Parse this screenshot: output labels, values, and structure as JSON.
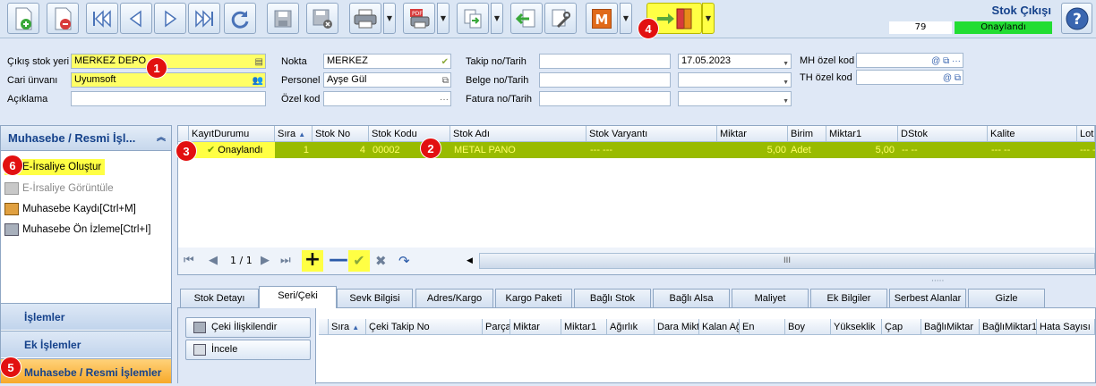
{
  "header": {
    "title": "Stok Çıkışı",
    "doc_no": "79",
    "status": "Onaylandı"
  },
  "form": {
    "cikis_stok_yeri": {
      "label": "Çıkış stok yeri",
      "value": "MERKEZ DEPO"
    },
    "cari_unvani": {
      "label": "Cari ünvanı",
      "value": "Uyumsoft"
    },
    "aciklama": {
      "label": "Açıklama",
      "value": ""
    },
    "nokta": {
      "label": "Nokta",
      "value": "MERKEZ"
    },
    "personel": {
      "label": "Personel",
      "value": "Ayşe Gül"
    },
    "ozel_kod": {
      "label": "Özel kod",
      "value": ""
    },
    "takip_no": {
      "label": "Takip no/Tarih",
      "value": "",
      "date": "17.05.2023"
    },
    "belge_no": {
      "label": "Belge no/Tarih",
      "value": "",
      "date": ""
    },
    "fatura_no": {
      "label": "Fatura no/Tarih",
      "value": "",
      "date": ""
    },
    "mh_ozel_kod": {
      "label": "MH özel kod",
      "value": ""
    },
    "th_ozel_kod": {
      "label": "TH özel kod",
      "value": ""
    }
  },
  "left_panel": {
    "title": "Muhasebe / Resmi İşl...",
    "items": [
      {
        "label": "E-İrsaliye Oluştur",
        "enabled": true
      },
      {
        "label": "E-İrsaliye Görüntüle",
        "enabled": false
      },
      {
        "label": "Muhasebe Kaydı[Ctrl+M]",
        "enabled": true
      },
      {
        "label": "Muhasebe Ön İzleme[Ctrl+I]",
        "enabled": true
      }
    ],
    "sections": [
      "İşlemler",
      "Ek İşlemler",
      "Muhasebe / Resmi İşlemler"
    ]
  },
  "grid": {
    "columns": [
      "KayıtDurumu",
      "Sıra",
      "Stok No",
      "Stok Kodu",
      "Stok Adı",
      "Stok Varyantı",
      "Miktar",
      "Birim",
      "Miktar1",
      "DStok",
      "Kalite",
      "Lot"
    ],
    "rows": [
      {
        "kayit_durumu": "Onaylandı",
        "sira": "1",
        "stok_no": "4",
        "stok_kodu": "00002",
        "stok_adi": "METAL PANO",
        "varyant": "--- ---",
        "miktar": "5,00",
        "birim": "Adet",
        "miktar1": "5,00",
        "dstok": "-- --",
        "kalite": "--- --",
        "lot": "--- -"
      }
    ],
    "pager": "1 / 1",
    "scroll_grip": "III"
  },
  "tabs": [
    "Stok Detayı",
    "Seri/Çeki",
    "Sevk Bilgisi",
    "Adres/Kargo",
    "Kargo Paketi",
    "Bağlı Stok",
    "Bağlı Alsa",
    "Maliyet",
    "Ek Bilgiler",
    "Serbest Alanlar",
    "Gizle"
  ],
  "active_tab": "Seri/Çeki",
  "sub": {
    "buttons": [
      "Çeki İlişkilendir",
      "İncele"
    ],
    "columns": [
      "Sıra",
      "Çeki Takip No",
      "Parça",
      "Miktar",
      "Miktar1",
      "Ağırlık",
      "Dara Mikt",
      "Kalan Ağ",
      "En",
      "Boy",
      "Yükseklik",
      "Çap",
      "BağlıMiktar",
      "BağlıMiktar1",
      "Hata Sayısı"
    ]
  },
  "badges": [
    "1",
    "2",
    "3",
    "4",
    "5",
    "6"
  ]
}
